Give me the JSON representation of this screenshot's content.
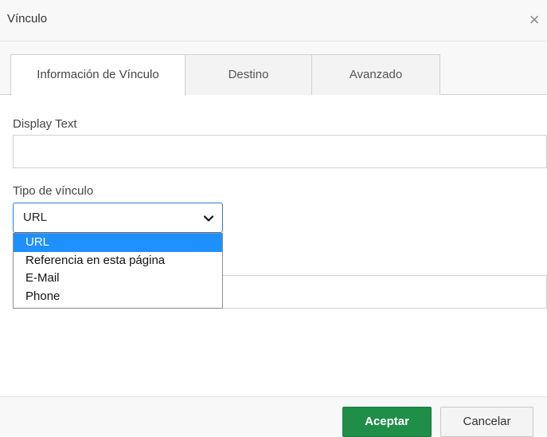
{
  "dialog": {
    "title": "Vínculo",
    "close_glyph": "×",
    "close_icon": "close-icon"
  },
  "tabs": [
    {
      "label": "Información de Vínculo",
      "active": true
    },
    {
      "label": "Destino",
      "active": false
    },
    {
      "label": "Avanzado",
      "active": false
    }
  ],
  "form": {
    "display_text": {
      "label": "Display Text",
      "value": ""
    },
    "link_type": {
      "label": "Tipo de vínculo",
      "selected": "URL",
      "chevron_icon": "chevron-down-icon",
      "options": [
        "URL",
        "Referencia en esta página",
        "E-Mail",
        "Phone"
      ],
      "highlighted_option": "URL"
    },
    "hidden_field": {
      "value": ""
    }
  },
  "footer": {
    "accept_label": "Aceptar",
    "cancel_label": "Cancelar"
  },
  "colors": {
    "primary_button": "#1f8e48",
    "focus_border": "#2e7bd1",
    "highlight": "#1e90ff"
  }
}
